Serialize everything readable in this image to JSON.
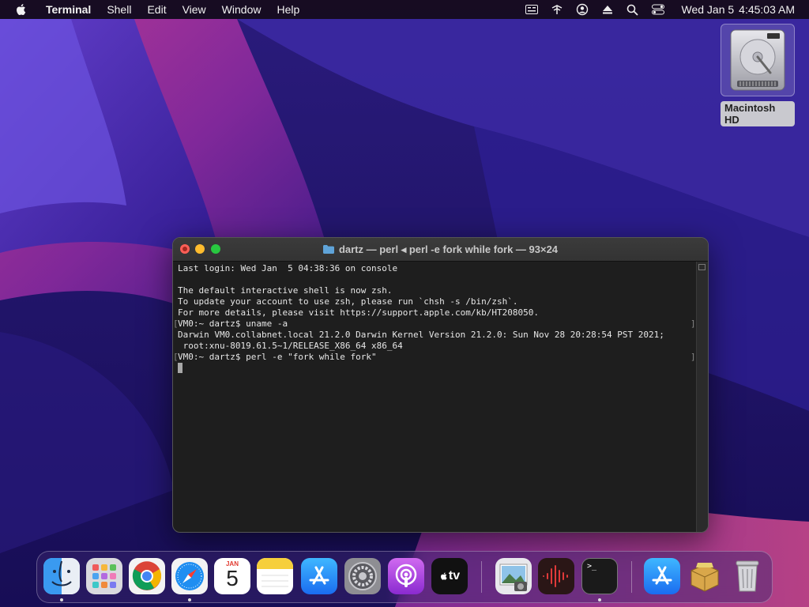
{
  "menubar": {
    "app_name": "Terminal",
    "menus": [
      "Shell",
      "Edit",
      "View",
      "Window",
      "Help"
    ],
    "status_icons": [
      "keyboard-input-icon",
      "wifi-icon",
      "user-icon",
      "eject-icon",
      "search-icon",
      "control-center-icon"
    ],
    "date": "Wed Jan 5",
    "time": "4:45:03 AM"
  },
  "desktop": {
    "disk_label": "Macintosh HD"
  },
  "terminal": {
    "title": "dartz — perl ◂ perl -e fork while fork — 93×24",
    "lines": [
      "Last login: Wed Jan  5 04:38:36 on console",
      "",
      "The default interactive shell is now zsh.",
      "To update your account to use zsh, please run `chsh -s /bin/zsh`.",
      "For more details, please visit https://support.apple.com/kb/HT208050.",
      "VM0:~ dartz$ uname -a",
      "Darwin VM0.collabnet.local 21.2.0 Darwin Kernel Version 21.2.0: Sun Nov 28 20:28:54 PST 2021;",
      " root:xnu-8019.61.5~1/RELEASE_X86_64 x86_64",
      "VM0:~ dartz$ perl -e \"fork while fork\""
    ]
  },
  "dock": {
    "calendar_month": "JAN",
    "calendar_day": "5",
    "appletv_label": "tv",
    "terminal_prompt": ">_",
    "apps": [
      "finder-icon",
      "launchpad-icon",
      "chrome-icon",
      "safari-icon",
      "calendar-icon",
      "notes-icon",
      "app-store-icon",
      "system-preferences-icon",
      "podcasts-icon",
      "apple-tv-icon",
      "preview-icon",
      "audio-app-icon",
      "terminal-icon",
      "app-store-downloads-icon",
      "archive-utility-icon",
      "trash-icon"
    ]
  }
}
